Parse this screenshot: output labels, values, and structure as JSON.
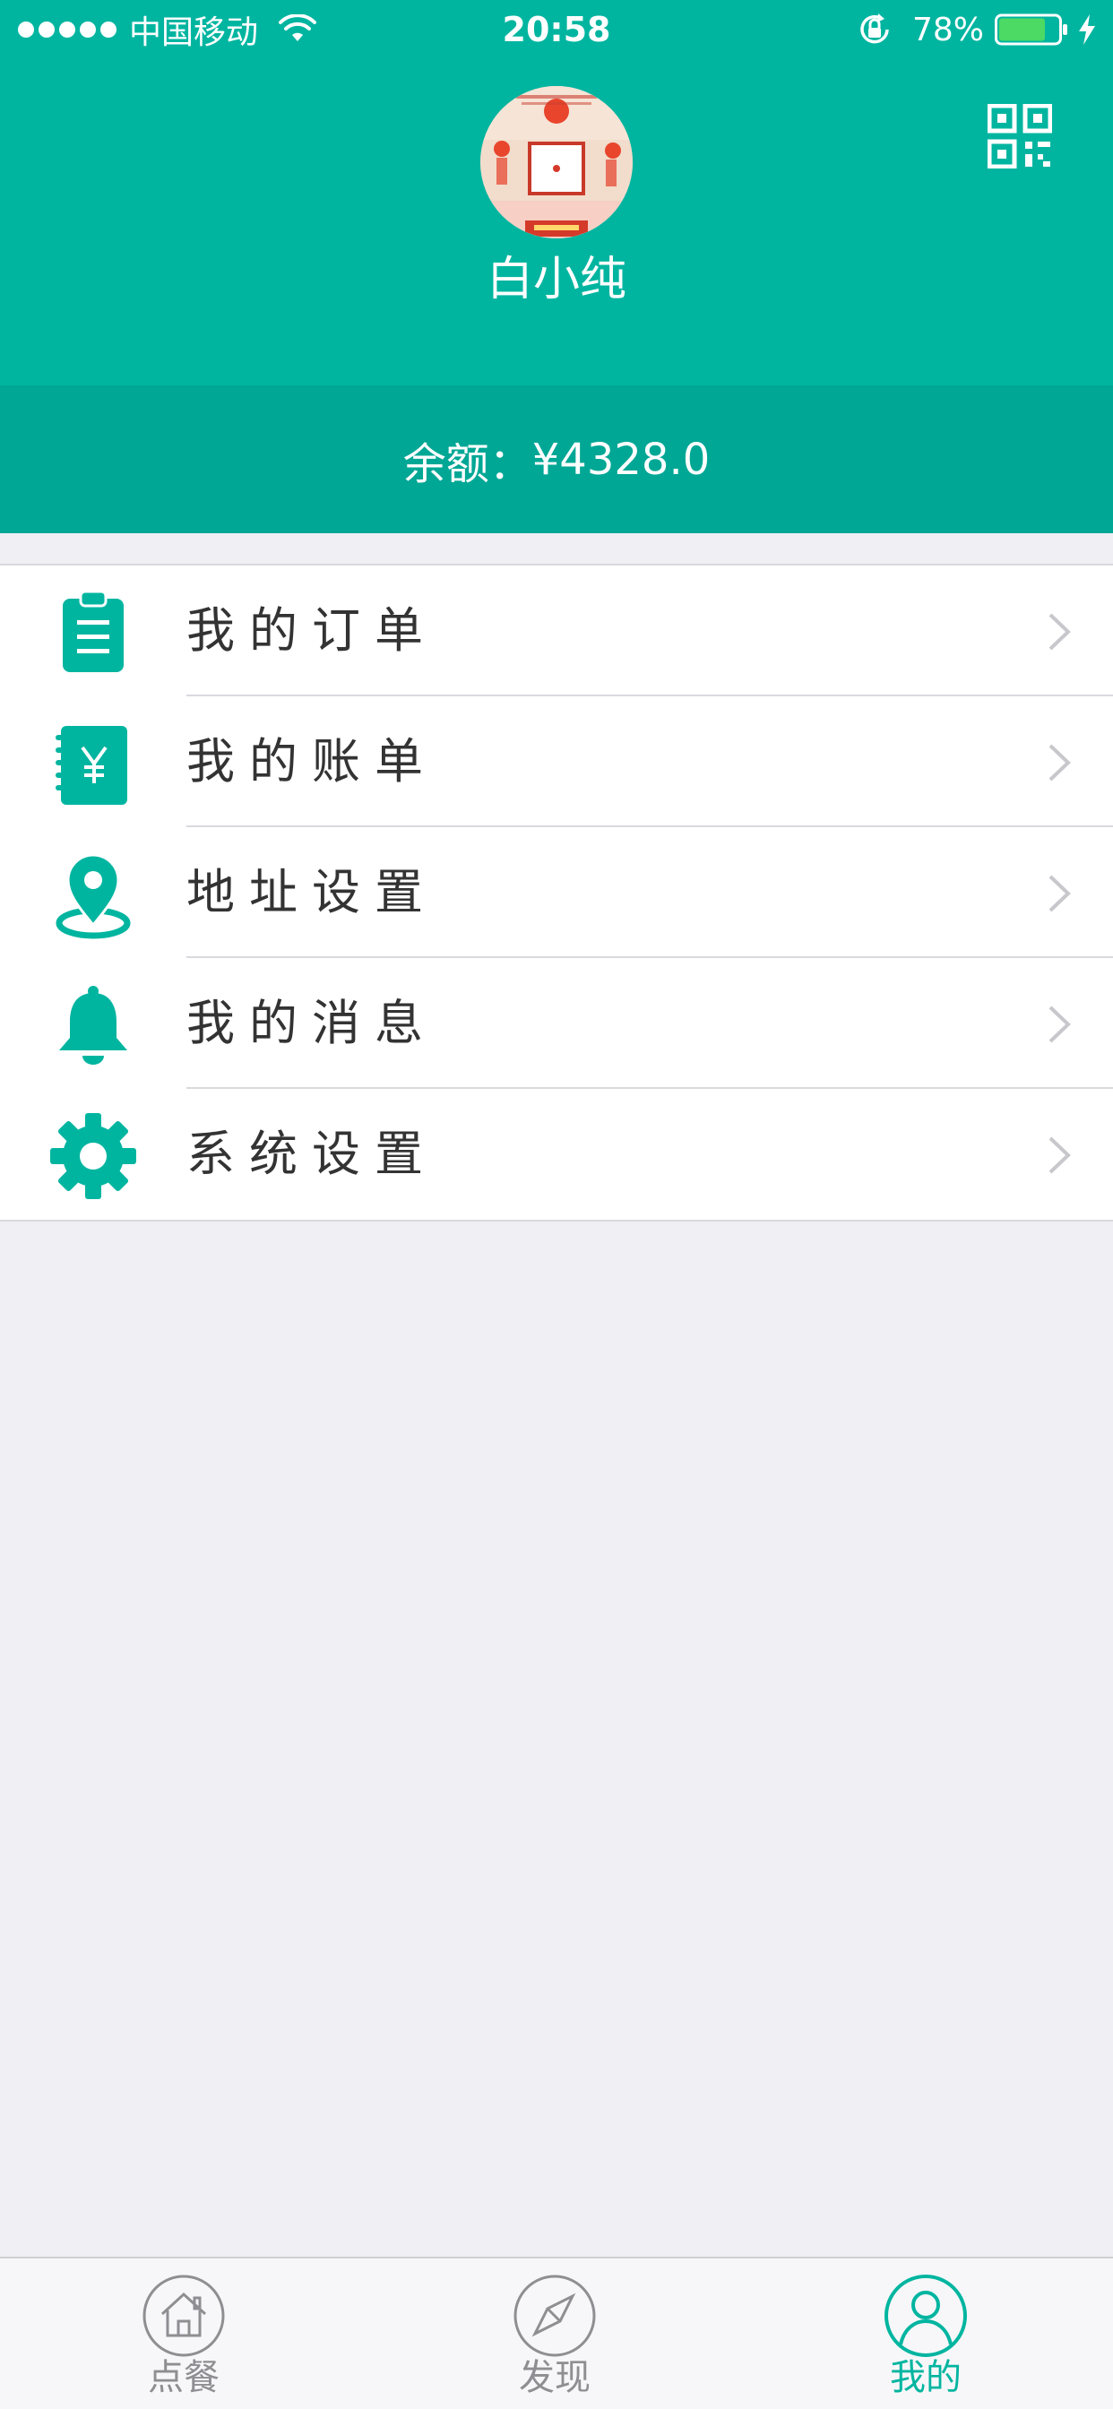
{
  "status_bar": {
    "carrier": "中国移动",
    "time": "20:58",
    "battery": "78%",
    "battery_level": 0.78
  },
  "profile": {
    "username": "白小纯",
    "avatar_icon": "avatar-photo",
    "qr_icon": "qr-code-icon"
  },
  "balance": {
    "label": "余额：",
    "amount": "¥4328.0"
  },
  "menu": {
    "items": [
      {
        "label": "我的订单",
        "icon": "clipboard-icon"
      },
      {
        "label": "我的账单",
        "icon": "bill-icon"
      },
      {
        "label": "地址设置",
        "icon": "location-pin-icon"
      },
      {
        "label": "我的消息",
        "icon": "bell-icon"
      },
      {
        "label": "系统设置",
        "icon": "gear-icon"
      }
    ]
  },
  "tabbar": {
    "tabs": [
      {
        "label": "点餐",
        "icon": "home-icon",
        "active": false
      },
      {
        "label": "发现",
        "icon": "compass-icon",
        "active": false
      },
      {
        "label": "我的",
        "icon": "profile-icon",
        "active": true
      }
    ]
  },
  "colors": {
    "primary": "#00b5a0",
    "primary_dark": "#00a795",
    "background": "#efeff4",
    "inactive_tab": "#8e8e93"
  }
}
